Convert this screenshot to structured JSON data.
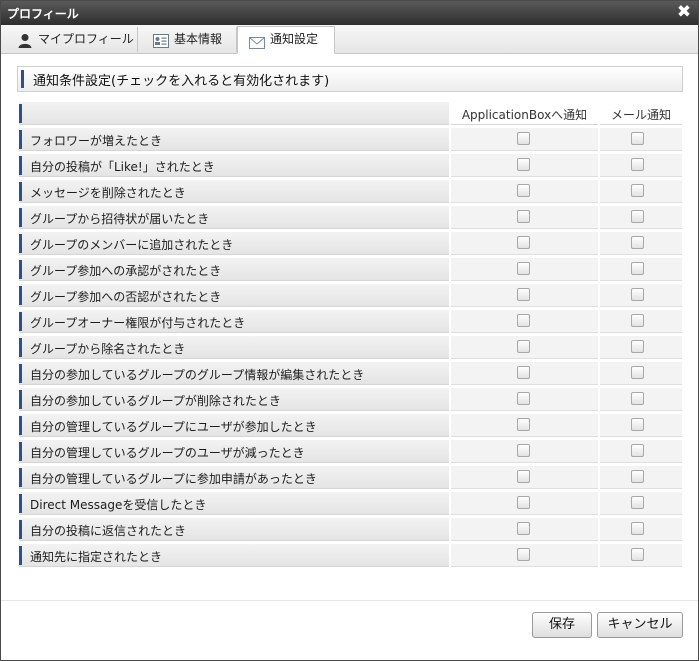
{
  "window": {
    "title": "プロフィール",
    "close_label": "✖"
  },
  "tabs": [
    {
      "label": "マイプロフィール",
      "icon": "person-icon"
    },
    {
      "label": "基本情報",
      "icon": "id-card-icon"
    },
    {
      "label": "通知設定",
      "icon": "envelope-icon"
    }
  ],
  "section": {
    "title": "通知条件設定(チェックを入れると有効化されます)"
  },
  "table": {
    "columns": {
      "label": "",
      "app_box": "ApplicationBoxへ通知",
      "mail": "メール通知"
    },
    "rows": [
      {
        "label": "フォロワーが増えたとき",
        "app_box": false,
        "mail": false
      },
      {
        "label": "自分の投稿が「Like!」されたとき",
        "app_box": false,
        "mail": false
      },
      {
        "label": "メッセージを削除されたとき",
        "app_box": false,
        "mail": false
      },
      {
        "label": "グループから招待状が届いたとき",
        "app_box": false,
        "mail": false
      },
      {
        "label": "グループのメンバーに追加されたとき",
        "app_box": false,
        "mail": false
      },
      {
        "label": "グループ参加への承認がされたとき",
        "app_box": false,
        "mail": false
      },
      {
        "label": "グループ参加への否認がされたとき",
        "app_box": false,
        "mail": false
      },
      {
        "label": "グループオーナー権限が付与されたとき",
        "app_box": false,
        "mail": false
      },
      {
        "label": "グループから除名されたとき",
        "app_box": false,
        "mail": false
      },
      {
        "label": "自分の参加しているグループのグループ情報が編集されたとき",
        "app_box": false,
        "mail": false
      },
      {
        "label": "自分の参加しているグループが削除されたとき",
        "app_box": false,
        "mail": false
      },
      {
        "label": "自分の管理しているグループにユーザが参加したとき",
        "app_box": false,
        "mail": false
      },
      {
        "label": "自分の管理しているグループのユーザが減ったとき",
        "app_box": false,
        "mail": false
      },
      {
        "label": "自分の管理しているグループに参加申請があったとき",
        "app_box": false,
        "mail": false
      },
      {
        "label": "Direct Messageを受信したとき",
        "app_box": false,
        "mail": false
      },
      {
        "label": "自分の投稿に返信されたとき",
        "app_box": false,
        "mail": false
      },
      {
        "label": "通知先に指定されたとき",
        "app_box": false,
        "mail": false
      }
    ]
  },
  "buttons": {
    "save": "保存",
    "cancel": "キャンセル"
  },
  "colors": {
    "accent_bar": "#2d4f8a",
    "titlebar": "#3c3c3c"
  }
}
